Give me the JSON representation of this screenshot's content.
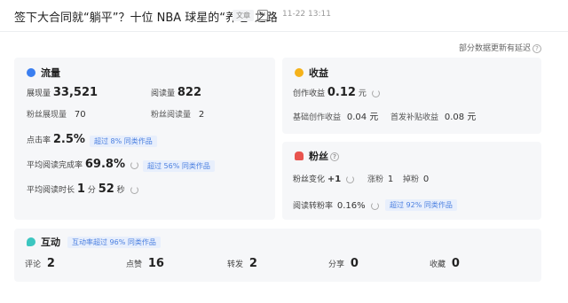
{
  "header": {
    "title": "签下大合同就“躺平”？十位 NBA 球星的“养老”之路",
    "tag": "文章",
    "ai_tag": "AI",
    "time": "11-22 13:11",
    "close": "×"
  },
  "delay_note": "部分数据更新有延迟",
  "traffic": {
    "title": "流量",
    "impressions_label": "展现量",
    "impressions_value": "33,521",
    "reads_label": "阅读量",
    "reads_value": "822",
    "fan_impressions_label": "粉丝展现量",
    "fan_impressions_value": "70",
    "fan_reads_label": "粉丝阅读量",
    "fan_reads_value": "2",
    "ctr_label": "点击率",
    "ctr_value": "2.5%",
    "ctr_badge": "超过 8% 同类作品",
    "completion_label": "平均阅读完成率",
    "completion_value": "69.8%",
    "completion_badge": "超过 56% 同类作品",
    "duration_label": "平均阅读时长",
    "duration_min": "1",
    "duration_min_unit": "分",
    "duration_sec": "52",
    "duration_sec_unit": "秒"
  },
  "income": {
    "title": "收益",
    "creation_label": "创作收益",
    "creation_value": "0.12",
    "creation_unit": "元",
    "base_label": "基础创作收益",
    "base_value": "0.04 元",
    "subsidy_label": "首发补贴收益",
    "subsidy_value": "0.08 元"
  },
  "fans": {
    "title": "粉丝",
    "change_label": "粉丝变化",
    "change_value": "+1",
    "gain_label": "涨粉",
    "gain_value": "1",
    "loss_label": "掉粉",
    "loss_value": "0",
    "convert_label": "阅读转粉率",
    "convert_value": "0.16%",
    "convert_badge": "超过 92% 同类作品"
  },
  "interact": {
    "title": "互动",
    "badge": "互动率超过 96% 同类作品",
    "comment_label": "评论",
    "comment_value": "2",
    "like_label": "点赞",
    "like_value": "16",
    "share_label": "转发",
    "share_value": "2",
    "forward_label": "分享",
    "forward_value": "0",
    "fav_label": "收藏",
    "fav_value": "0"
  },
  "colors": {
    "traffic_icon": "#3b7ff0",
    "income_icon": "#f5b21a",
    "fans_icon": "#e8544e",
    "interact_icon": "#3cc6c0",
    "badge_text": "#4a7fe0"
  }
}
